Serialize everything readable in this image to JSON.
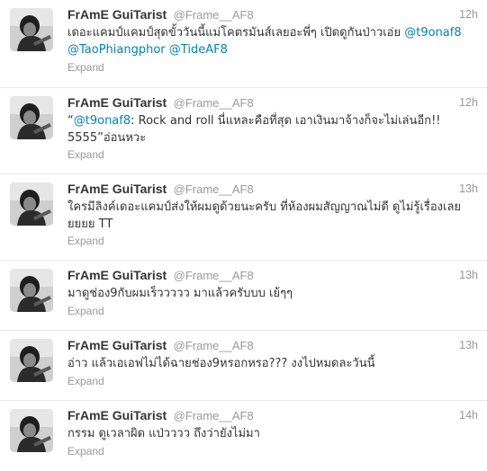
{
  "tweets": [
    {
      "fullname": "FrAmE GuiTarist",
      "username": "@Frame__AF8",
      "time": "12h",
      "text_pre": "เดอะแคมป์แคมป์สุดขั้ววันนี้แม่โคตรมันส์เลยอะพี่ๆ เปิดดูกันป่าวเอ่ย ",
      "mention1": "@t9onaf8",
      "mention2": "@TaoPhiangphor",
      "mention3": "@TideAF8",
      "expand": "Expand"
    },
    {
      "fullname": "FrAmE GuiTarist",
      "username": "@Frame__AF8",
      "time": "12h",
      "text_pre": "“",
      "mention1": "@t9onaf8",
      "text_post": ": Rock and roll นี่แหละคือที่สุด เอาเงินมาจ้างก็จะไม่เล่นอีก!! 5555”อ่อนหวะ",
      "expand": "Expand"
    },
    {
      "fullname": "FrAmE GuiTarist",
      "username": "@Frame__AF8",
      "time": "13h",
      "text": "ใครมีลิงค์เดอะแคมป์ส่งให้ผมดูด้วยนะครับ ที่ห้องผมสัญญาณไม่ดี ดูไม่รู้เรื่องเลยยยยย TT",
      "expand": "Expand"
    },
    {
      "fullname": "FrAmE GuiTarist",
      "username": "@Frame__AF8",
      "time": "13h",
      "text": "มาดูช่อง9กับผมเร็ววววว มาแล้วครับบบ เย้ๆๆ",
      "expand": "Expand"
    },
    {
      "fullname": "FrAmE GuiTarist",
      "username": "@Frame__AF8",
      "time": "13h",
      "text": "อ่าว แล้วเอเอฟไม่ได้ฉายช่อง9หรอกหรอ??? งงไปหมดละวันนี้",
      "expand": "Expand"
    },
    {
      "fullname": "FrAmE GuiTarist",
      "username": "@Frame__AF8",
      "time": "14h",
      "text": "กรรม ดูเวลาผิด แป่วววว ถึงว่ายังไม่มา",
      "expand": "Expand"
    }
  ],
  "colors": {
    "link": "#0084b4",
    "muted": "#999999",
    "text": "#333333",
    "divider": "#e8e8e8"
  },
  "icons": {
    "avatar": "user-photo-avatar"
  }
}
